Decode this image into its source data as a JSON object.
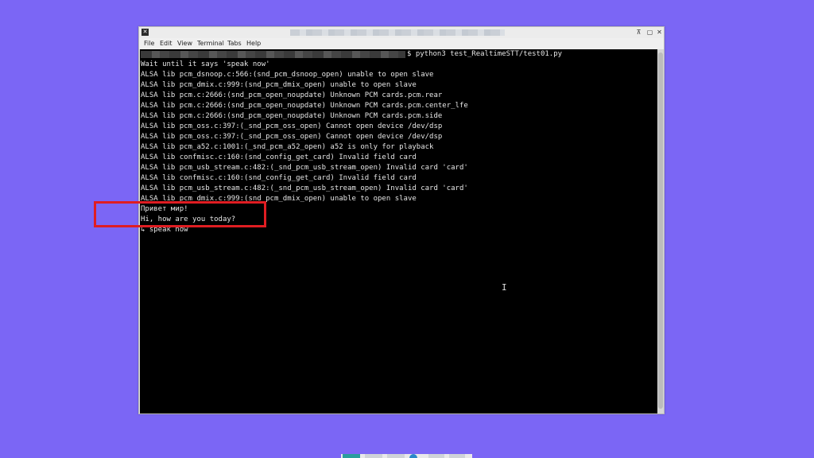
{
  "window": {
    "menu": [
      "File",
      "Edit",
      "View",
      "Terminal",
      "Tabs",
      "Help"
    ]
  },
  "terminal": {
    "command": "$ python3 test_RealtimeSTT/test01.py",
    "lines": [
      "Wait until it says 'speak now'",
      "ALSA lib pcm_dsnoop.c:566:(snd_pcm_dsnoop_open) unable to open slave",
      "ALSA lib pcm_dmix.c:999:(snd_pcm_dmix_open) unable to open slave",
      "ALSA lib pcm.c:2666:(snd_pcm_open_noupdate) Unknown PCM cards.pcm.rear",
      "ALSA lib pcm.c:2666:(snd_pcm_open_noupdate) Unknown PCM cards.pcm.center_lfe",
      "ALSA lib pcm.c:2666:(snd_pcm_open_noupdate) Unknown PCM cards.pcm.side",
      "ALSA lib pcm_oss.c:397:(_snd_pcm_oss_open) Cannot open device /dev/dsp",
      "ALSA lib pcm_oss.c:397:(_snd_pcm_oss_open) Cannot open device /dev/dsp",
      "ALSA lib pcm_a52.c:1001:(_snd_pcm_a52_open) a52 is only for playback",
      "ALSA lib confmisc.c:160:(snd_config_get_card) Invalid field card",
      "ALSA lib pcm_usb_stream.c:482:(_snd_pcm_usb_stream_open) Invalid card 'card'",
      "ALSA lib confmisc.c:160:(snd_config_get_card) Invalid field card",
      "ALSA lib pcm_usb_stream.c:482:(_snd_pcm_usb_stream_open) Invalid card 'card'",
      "ALSA lib pcm_dmix.c:999:(snd_pcm_dmix_open) unable to open slave",
      "Привет мир!",
      "Hi, how are you today?",
      "↳ speak now"
    ]
  },
  "colors": {
    "desktop": "#7b66f5",
    "highlight": "#e01d22"
  }
}
